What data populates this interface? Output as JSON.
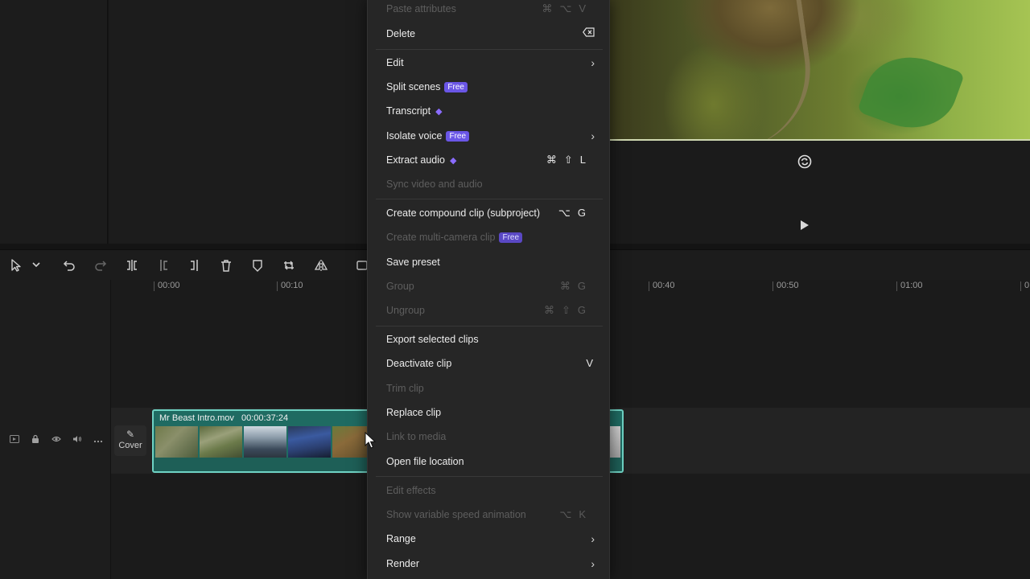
{
  "preview": {
    "loop_icon": "loop-icon",
    "play_icon": "play-icon"
  },
  "toolbar": {
    "tools": [
      {
        "name": "select-pointer-icon"
      },
      {
        "name": "chevron-down-icon"
      },
      {
        "name": "undo-icon"
      },
      {
        "name": "redo-icon"
      },
      {
        "name": "split-icon"
      },
      {
        "name": "trim-left-icon"
      },
      {
        "name": "trim-right-icon"
      },
      {
        "name": "delete-icon"
      },
      {
        "name": "marker-icon"
      },
      {
        "name": "crop-rotate-icon"
      },
      {
        "name": "mirror-icon"
      },
      {
        "name": "more-tools-icon"
      }
    ]
  },
  "ruler": {
    "ticks": [
      "00:00",
      "00:10",
      "00:40",
      "00:50",
      "01:00",
      "0"
    ]
  },
  "track": {
    "cover_label": "Cover"
  },
  "clip": {
    "name": "Mr Beast Intro.mov",
    "duration": "00:00:37:24",
    "color": "#1f6b62",
    "border_color": "#6fd3c4"
  },
  "menu": {
    "items": [
      {
        "label": "Paste attributes",
        "shortcut": "⌘⌥V",
        "disabled": true
      },
      {
        "label": "Delete",
        "shortcut_icon": "backspace-icon",
        "disabled": false
      },
      {
        "label": "Edit",
        "submenu": true,
        "disabled": false
      },
      {
        "label": "Split scenes",
        "badge": "Free",
        "disabled": false
      },
      {
        "label": "Transcript",
        "pro": true,
        "disabled": false
      },
      {
        "label": "Isolate voice",
        "badge": "Free",
        "submenu": true,
        "disabled": false
      },
      {
        "label": "Extract audio",
        "pro": true,
        "shortcut": "⌘⇧L",
        "disabled": false
      },
      {
        "label": "Sync video and audio",
        "disabled": true
      },
      {
        "label": "Create compound clip (subproject)",
        "shortcut": "⌥G",
        "disabled": false
      },
      {
        "label": "Create multi-camera clip",
        "badge": "Free",
        "disabled": true
      },
      {
        "label": "Save preset",
        "disabled": false
      },
      {
        "label": "Group",
        "shortcut": "⌘G",
        "disabled": true
      },
      {
        "label": "Ungroup",
        "shortcut": "⌘⇧G",
        "disabled": true
      },
      {
        "label": "Export selected clips",
        "disabled": false
      },
      {
        "label": "Deactivate clip",
        "shortcut": "V",
        "disabled": false
      },
      {
        "label": "Trim clip",
        "disabled": true
      },
      {
        "label": "Replace clip",
        "disabled": false
      },
      {
        "label": "Link to media",
        "disabled": true
      },
      {
        "label": "Open file location",
        "disabled": false
      },
      {
        "label": "Edit effects",
        "disabled": true
      },
      {
        "label": "Show variable speed animation",
        "shortcut": "⌥K",
        "disabled": true
      },
      {
        "label": "Range",
        "submenu": true,
        "disabled": false
      },
      {
        "label": "Render",
        "submenu": true,
        "disabled": false
      }
    ],
    "accent_badge_color": "#6a56e6"
  }
}
